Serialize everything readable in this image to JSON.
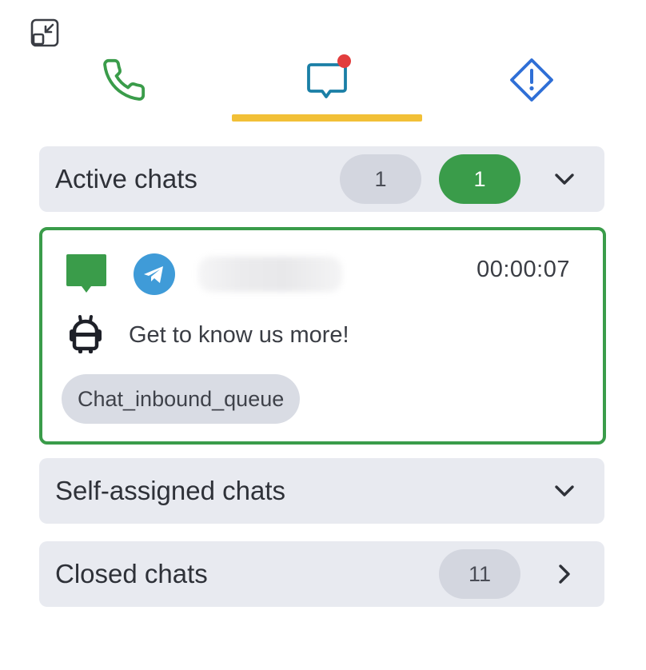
{
  "header": {
    "collapse_icon": "collapse-arrows-icon"
  },
  "tabs": [
    {
      "name": "phone",
      "icon": "phone-icon",
      "color": "#3a9c4a"
    },
    {
      "name": "chats",
      "icon": "chat-bubble-icon",
      "color": "#1a7fa6",
      "active": true,
      "has_notification": true
    },
    {
      "name": "alerts",
      "icon": "warning-diamond-icon",
      "color": "#2f6fd6"
    }
  ],
  "colors": {
    "accent_underline": "#f2c037",
    "notification": "#e23d3d",
    "green": "#3a9c4a",
    "section_bg": "#e8eaf0"
  },
  "sections": {
    "active": {
      "title": "Active chats",
      "count_gray": "1",
      "count_green": "1",
      "chevron": "chevron-down-icon"
    },
    "self_assigned": {
      "title": "Self-assigned chats",
      "chevron": "chevron-down-icon"
    },
    "closed": {
      "title": "Closed chats",
      "count": "11",
      "chevron": "chevron-right-icon"
    }
  },
  "chat": {
    "status_icon": "chat-square-icon",
    "channel_icon": "telegram-icon",
    "timer": "00:00:07",
    "bot_icon": "robot-icon",
    "message": "Get to know us more!",
    "queue": "Chat_inbound_queue"
  }
}
